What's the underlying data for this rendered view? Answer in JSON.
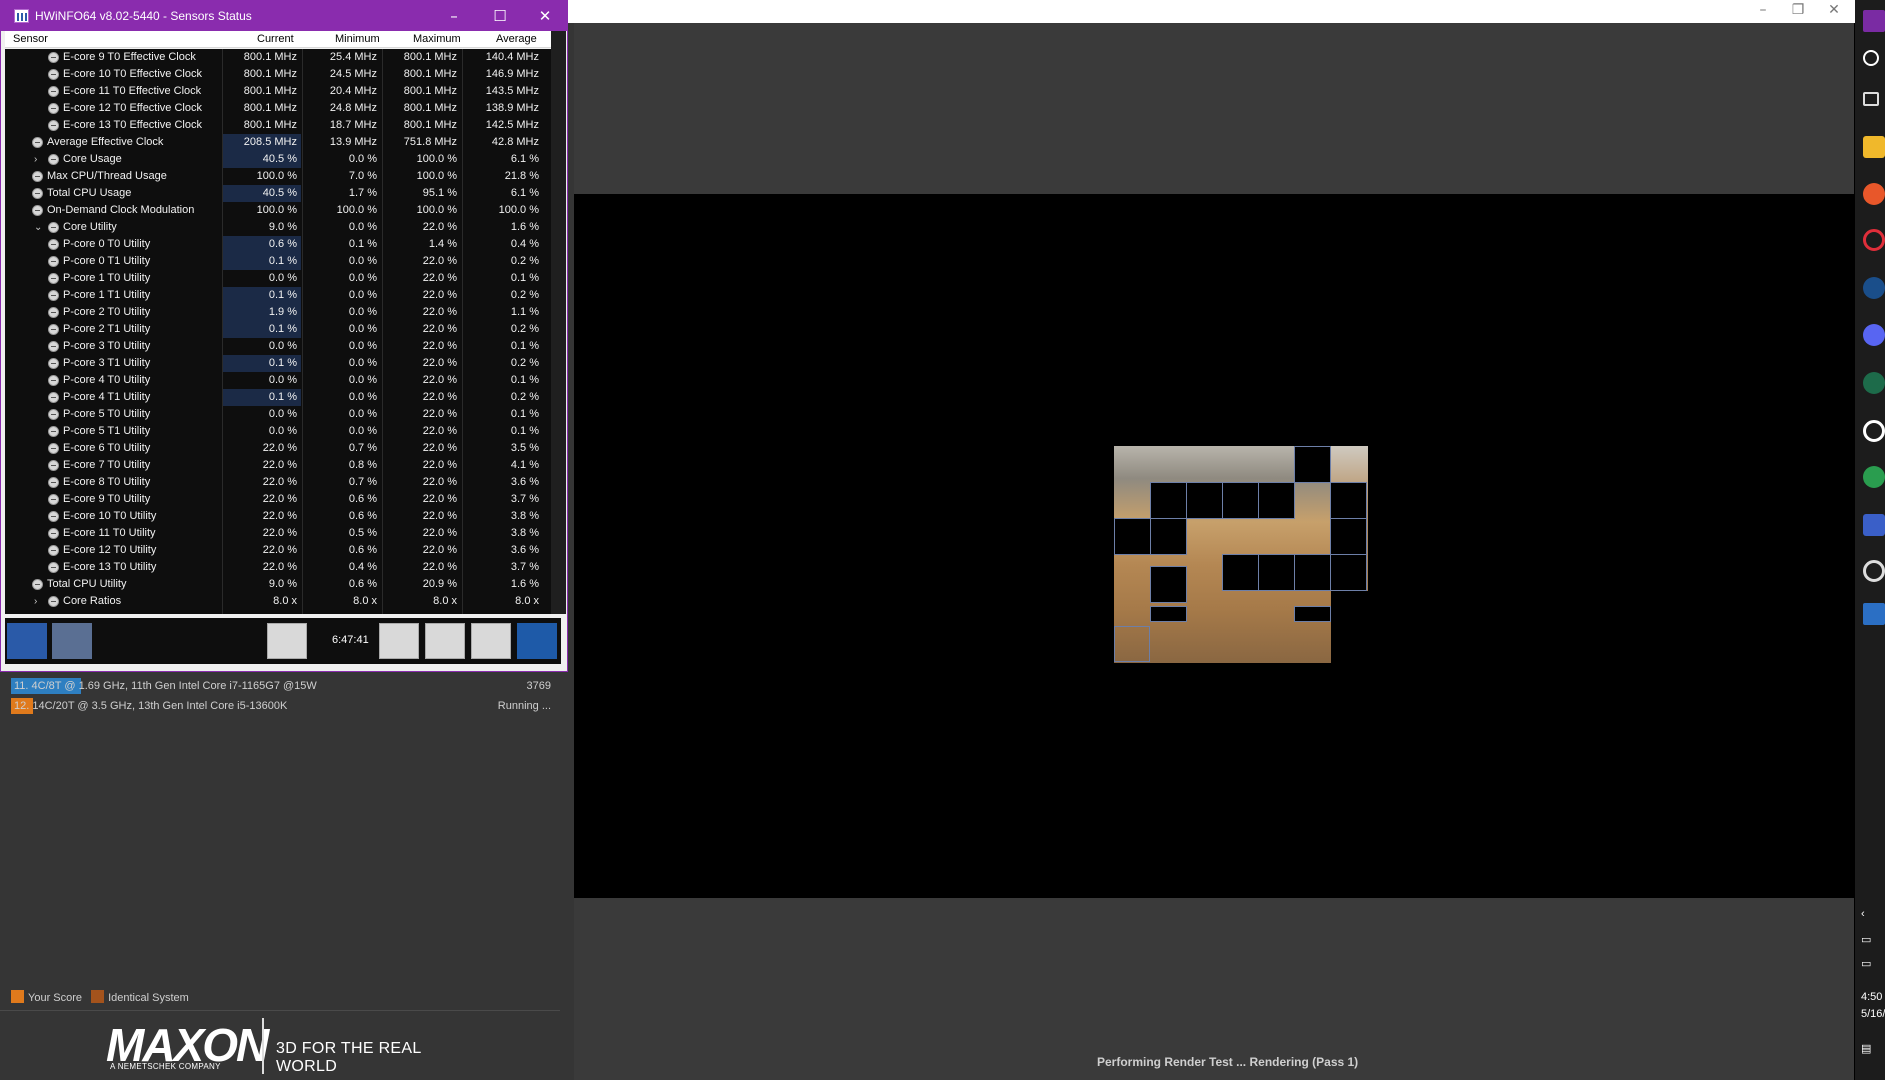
{
  "hwinfo": {
    "title": "HWiNFO64 v8.02-5440 - Sensors Status",
    "columns": [
      "Sensor",
      "Current",
      "Minimum",
      "Maximum",
      "Average"
    ],
    "rows": [
      {
        "indent": 2,
        "expander": "",
        "name": "E-core 9 T0 Effective Clock",
        "cur": "800.1 MHz",
        "min": "25.4 MHz",
        "max": "800.1 MHz",
        "avg": "140.4 MHz",
        "hl": false
      },
      {
        "indent": 2,
        "expander": "",
        "name": "E-core 10 T0 Effective Clock",
        "cur": "800.1 MHz",
        "min": "24.5 MHz",
        "max": "800.1 MHz",
        "avg": "146.9 MHz",
        "hl": false
      },
      {
        "indent": 2,
        "expander": "",
        "name": "E-core 11 T0 Effective Clock",
        "cur": "800.1 MHz",
        "min": "20.4 MHz",
        "max": "800.1 MHz",
        "avg": "143.5 MHz",
        "hl": false
      },
      {
        "indent": 2,
        "expander": "",
        "name": "E-core 12 T0 Effective Clock",
        "cur": "800.1 MHz",
        "min": "24.8 MHz",
        "max": "800.1 MHz",
        "avg": "138.9 MHz",
        "hl": false
      },
      {
        "indent": 2,
        "expander": "",
        "name": "E-core 13 T0 Effective Clock",
        "cur": "800.1 MHz",
        "min": "18.7 MHz",
        "max": "800.1 MHz",
        "avg": "142.5 MHz",
        "hl": false
      },
      {
        "indent": 1,
        "expander": "",
        "name": "Average Effective Clock",
        "cur": "208.5 MHz",
        "min": "13.9 MHz",
        "max": "751.8 MHz",
        "avg": "42.8 MHz",
        "hl": true
      },
      {
        "indent": 2,
        "expander": "›",
        "name": "Core Usage",
        "cur": "40.5 %",
        "min": "0.0 %",
        "max": "100.0 %",
        "avg": "6.1 %",
        "hl": true
      },
      {
        "indent": 1,
        "expander": "",
        "name": "Max CPU/Thread Usage",
        "cur": "100.0 %",
        "min": "7.0 %",
        "max": "100.0 %",
        "avg": "21.8 %",
        "hl": false
      },
      {
        "indent": 1,
        "expander": "",
        "name": "Total CPU Usage",
        "cur": "40.5 %",
        "min": "1.7 %",
        "max": "95.1 %",
        "avg": "6.1 %",
        "hl": true
      },
      {
        "indent": 1,
        "expander": "",
        "name": "On-Demand Clock Modulation",
        "cur": "100.0 %",
        "min": "100.0 %",
        "max": "100.0 %",
        "avg": "100.0 %",
        "hl": false
      },
      {
        "indent": 2,
        "expander": "⌄",
        "name": "Core Utility",
        "cur": "9.0 %",
        "min": "0.0 %",
        "max": "22.0 %",
        "avg": "1.6 %",
        "hl": false
      },
      {
        "indent": 2,
        "expander": "",
        "name": "P-core 0 T0 Utility",
        "cur": "0.6 %",
        "min": "0.1 %",
        "max": "1.4 %",
        "avg": "0.4 %",
        "hl": true
      },
      {
        "indent": 2,
        "expander": "",
        "name": "P-core 0 T1 Utility",
        "cur": "0.1 %",
        "min": "0.0 %",
        "max": "22.0 %",
        "avg": "0.2 %",
        "hl": true
      },
      {
        "indent": 2,
        "expander": "",
        "name": "P-core 1 T0 Utility",
        "cur": "0.0 %",
        "min": "0.0 %",
        "max": "22.0 %",
        "avg": "0.1 %",
        "hl": false
      },
      {
        "indent": 2,
        "expander": "",
        "name": "P-core 1 T1 Utility",
        "cur": "0.1 %",
        "min": "0.0 %",
        "max": "22.0 %",
        "avg": "0.2 %",
        "hl": true
      },
      {
        "indent": 2,
        "expander": "",
        "name": "P-core 2 T0 Utility",
        "cur": "1.9 %",
        "min": "0.0 %",
        "max": "22.0 %",
        "avg": "1.1 %",
        "hl": true
      },
      {
        "indent": 2,
        "expander": "",
        "name": "P-core 2 T1 Utility",
        "cur": "0.1 %",
        "min": "0.0 %",
        "max": "22.0 %",
        "avg": "0.2 %",
        "hl": true
      },
      {
        "indent": 2,
        "expander": "",
        "name": "P-core 3 T0 Utility",
        "cur": "0.0 %",
        "min": "0.0 %",
        "max": "22.0 %",
        "avg": "0.1 %",
        "hl": false
      },
      {
        "indent": 2,
        "expander": "",
        "name": "P-core 3 T1 Utility",
        "cur": "0.1 %",
        "min": "0.0 %",
        "max": "22.0 %",
        "avg": "0.2 %",
        "hl": true
      },
      {
        "indent": 2,
        "expander": "",
        "name": "P-core 4 T0 Utility",
        "cur": "0.0 %",
        "min": "0.0 %",
        "max": "22.0 %",
        "avg": "0.1 %",
        "hl": false
      },
      {
        "indent": 2,
        "expander": "",
        "name": "P-core 4 T1 Utility",
        "cur": "0.1 %",
        "min": "0.0 %",
        "max": "22.0 %",
        "avg": "0.2 %",
        "hl": true
      },
      {
        "indent": 2,
        "expander": "",
        "name": "P-core 5 T0 Utility",
        "cur": "0.0 %",
        "min": "0.0 %",
        "max": "22.0 %",
        "avg": "0.1 %",
        "hl": false
      },
      {
        "indent": 2,
        "expander": "",
        "name": "P-core 5 T1 Utility",
        "cur": "0.0 %",
        "min": "0.0 %",
        "max": "22.0 %",
        "avg": "0.1 %",
        "hl": false
      },
      {
        "indent": 2,
        "expander": "",
        "name": "E-core 6 T0 Utility",
        "cur": "22.0 %",
        "min": "0.7 %",
        "max": "22.0 %",
        "avg": "3.5 %",
        "hl": false
      },
      {
        "indent": 2,
        "expander": "",
        "name": "E-core 7 T0 Utility",
        "cur": "22.0 %",
        "min": "0.8 %",
        "max": "22.0 %",
        "avg": "4.1 %",
        "hl": false
      },
      {
        "indent": 2,
        "expander": "",
        "name": "E-core 8 T0 Utility",
        "cur": "22.0 %",
        "min": "0.7 %",
        "max": "22.0 %",
        "avg": "3.6 %",
        "hl": false
      },
      {
        "indent": 2,
        "expander": "",
        "name": "E-core 9 T0 Utility",
        "cur": "22.0 %",
        "min": "0.6 %",
        "max": "22.0 %",
        "avg": "3.7 %",
        "hl": false
      },
      {
        "indent": 2,
        "expander": "",
        "name": "E-core 10 T0 Utility",
        "cur": "22.0 %",
        "min": "0.6 %",
        "max": "22.0 %",
        "avg": "3.8 %",
        "hl": false
      },
      {
        "indent": 2,
        "expander": "",
        "name": "E-core 11 T0 Utility",
        "cur": "22.0 %",
        "min": "0.5 %",
        "max": "22.0 %",
        "avg": "3.8 %",
        "hl": false
      },
      {
        "indent": 2,
        "expander": "",
        "name": "E-core 12 T0 Utility",
        "cur": "22.0 %",
        "min": "0.6 %",
        "max": "22.0 %",
        "avg": "3.6 %",
        "hl": false
      },
      {
        "indent": 2,
        "expander": "",
        "name": "E-core 13 T0 Utility",
        "cur": "22.0 %",
        "min": "0.4 %",
        "max": "22.0 %",
        "avg": "3.7 %",
        "hl": false
      },
      {
        "indent": 1,
        "expander": "",
        "name": "Total CPU Utility",
        "cur": "9.0 %",
        "min": "0.6 %",
        "max": "20.9 %",
        "avg": "1.6 %",
        "hl": false
      },
      {
        "indent": 2,
        "expander": "›",
        "name": "Core Ratios",
        "cur": "8.0 x",
        "min": "8.0 x",
        "max": "8.0 x",
        "avg": "8.0 x",
        "hl": false
      }
    ],
    "toolbar": {
      "time": "6:47:41",
      "buttons": [
        "nav-arrows-icon",
        "nav-collapse-icon",
        "network-icon",
        "clock-icon",
        "add-report-icon",
        "settings-gear-icon",
        "close-x-icon"
      ]
    }
  },
  "cinebench": {
    "ranking": [
      {
        "rank": "11.",
        "desc": "4C/8T @ 1.69 GHz, 11th Gen Intel Core i7-1165G7 @15W",
        "score": "3769",
        "bar_color": "#2e7fc1",
        "bar_fraction": 0.13
      },
      {
        "rank": "12.",
        "desc": "14C/20T @ 3.5 GHz, 13th Gen Intel Core i5-13600K",
        "score": "Running ...",
        "bar_color": "#e07a1c",
        "bar_fraction": 0.04
      }
    ],
    "legend": {
      "your_score": "Your Score",
      "identical": "Identical System",
      "your_color": "#e07a1c",
      "identical_color": "#a4531c"
    },
    "brand": {
      "logo": "MAXON",
      "sub": "A NEMETSCHEK COMPANY",
      "tagline": "3D FOR THE REAL WORLD"
    },
    "status": "Performing Render Test ... Rendering (Pass 1)",
    "window_controls": [
      "–",
      "❐",
      "✕"
    ]
  },
  "taskbar": {
    "time": "4:50",
    "date": "5/16/"
  }
}
